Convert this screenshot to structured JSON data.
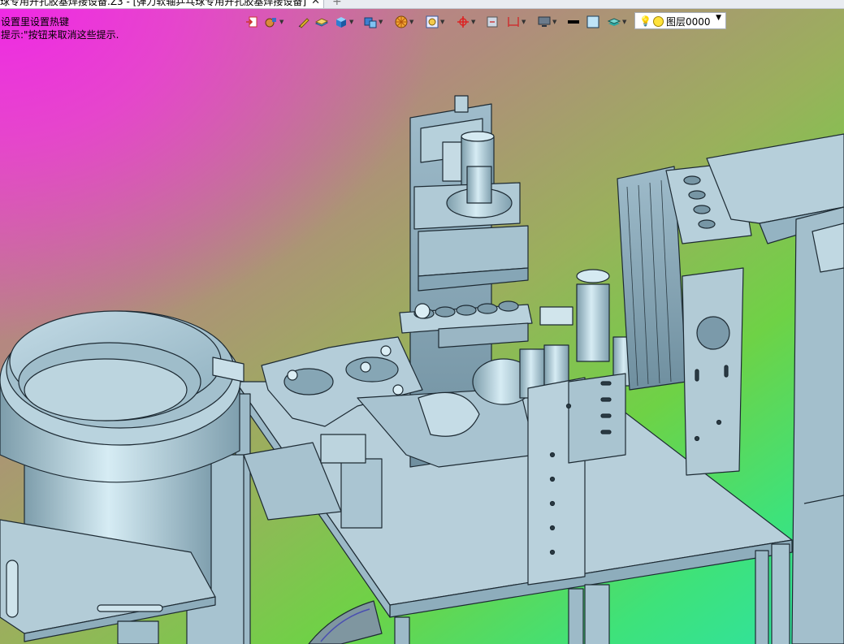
{
  "document_tab": {
    "title": "球专用开孔胶基焊接设备.Z3 - [弹力软轴乒乓球专用开孔胶基焊接设备]",
    "close_glyph": "✕",
    "new_tab_glyph": "+"
  },
  "hints": {
    "line1": "设置里设置热键",
    "line2": "提示:\"按钮来取消这些提示."
  },
  "toolbar": {
    "items": [
      {
        "icon": "exit-sketch-icon"
      },
      {
        "icon": "view-style-icon"
      },
      {
        "icon": "pen-draw-icon"
      },
      {
        "icon": "plane-icon"
      },
      {
        "icon": "shaded-cube-icon"
      },
      {
        "icon": "display-cube-icon"
      },
      {
        "icon": "color-wheel-icon"
      },
      {
        "icon": "zoom-view-icon"
      },
      {
        "icon": "snap-point-icon"
      },
      {
        "icon": "section-view-icon"
      },
      {
        "icon": "dimension-icon"
      },
      {
        "icon": "monitor-icon"
      },
      {
        "icon": "line-style-icon"
      },
      {
        "icon": "fill-color-icon"
      },
      {
        "icon": "layers-stack-icon"
      }
    ]
  },
  "layer_select": {
    "value": "图层0000",
    "dropdown_glyph": "▼"
  },
  "colors": {
    "bg_magenta": "#f028e6",
    "bg_green": "#3ee27a",
    "bg_teal": "#2de2a6",
    "model_metal": "#a9c6d3",
    "model_edge": "#1d2a33"
  }
}
